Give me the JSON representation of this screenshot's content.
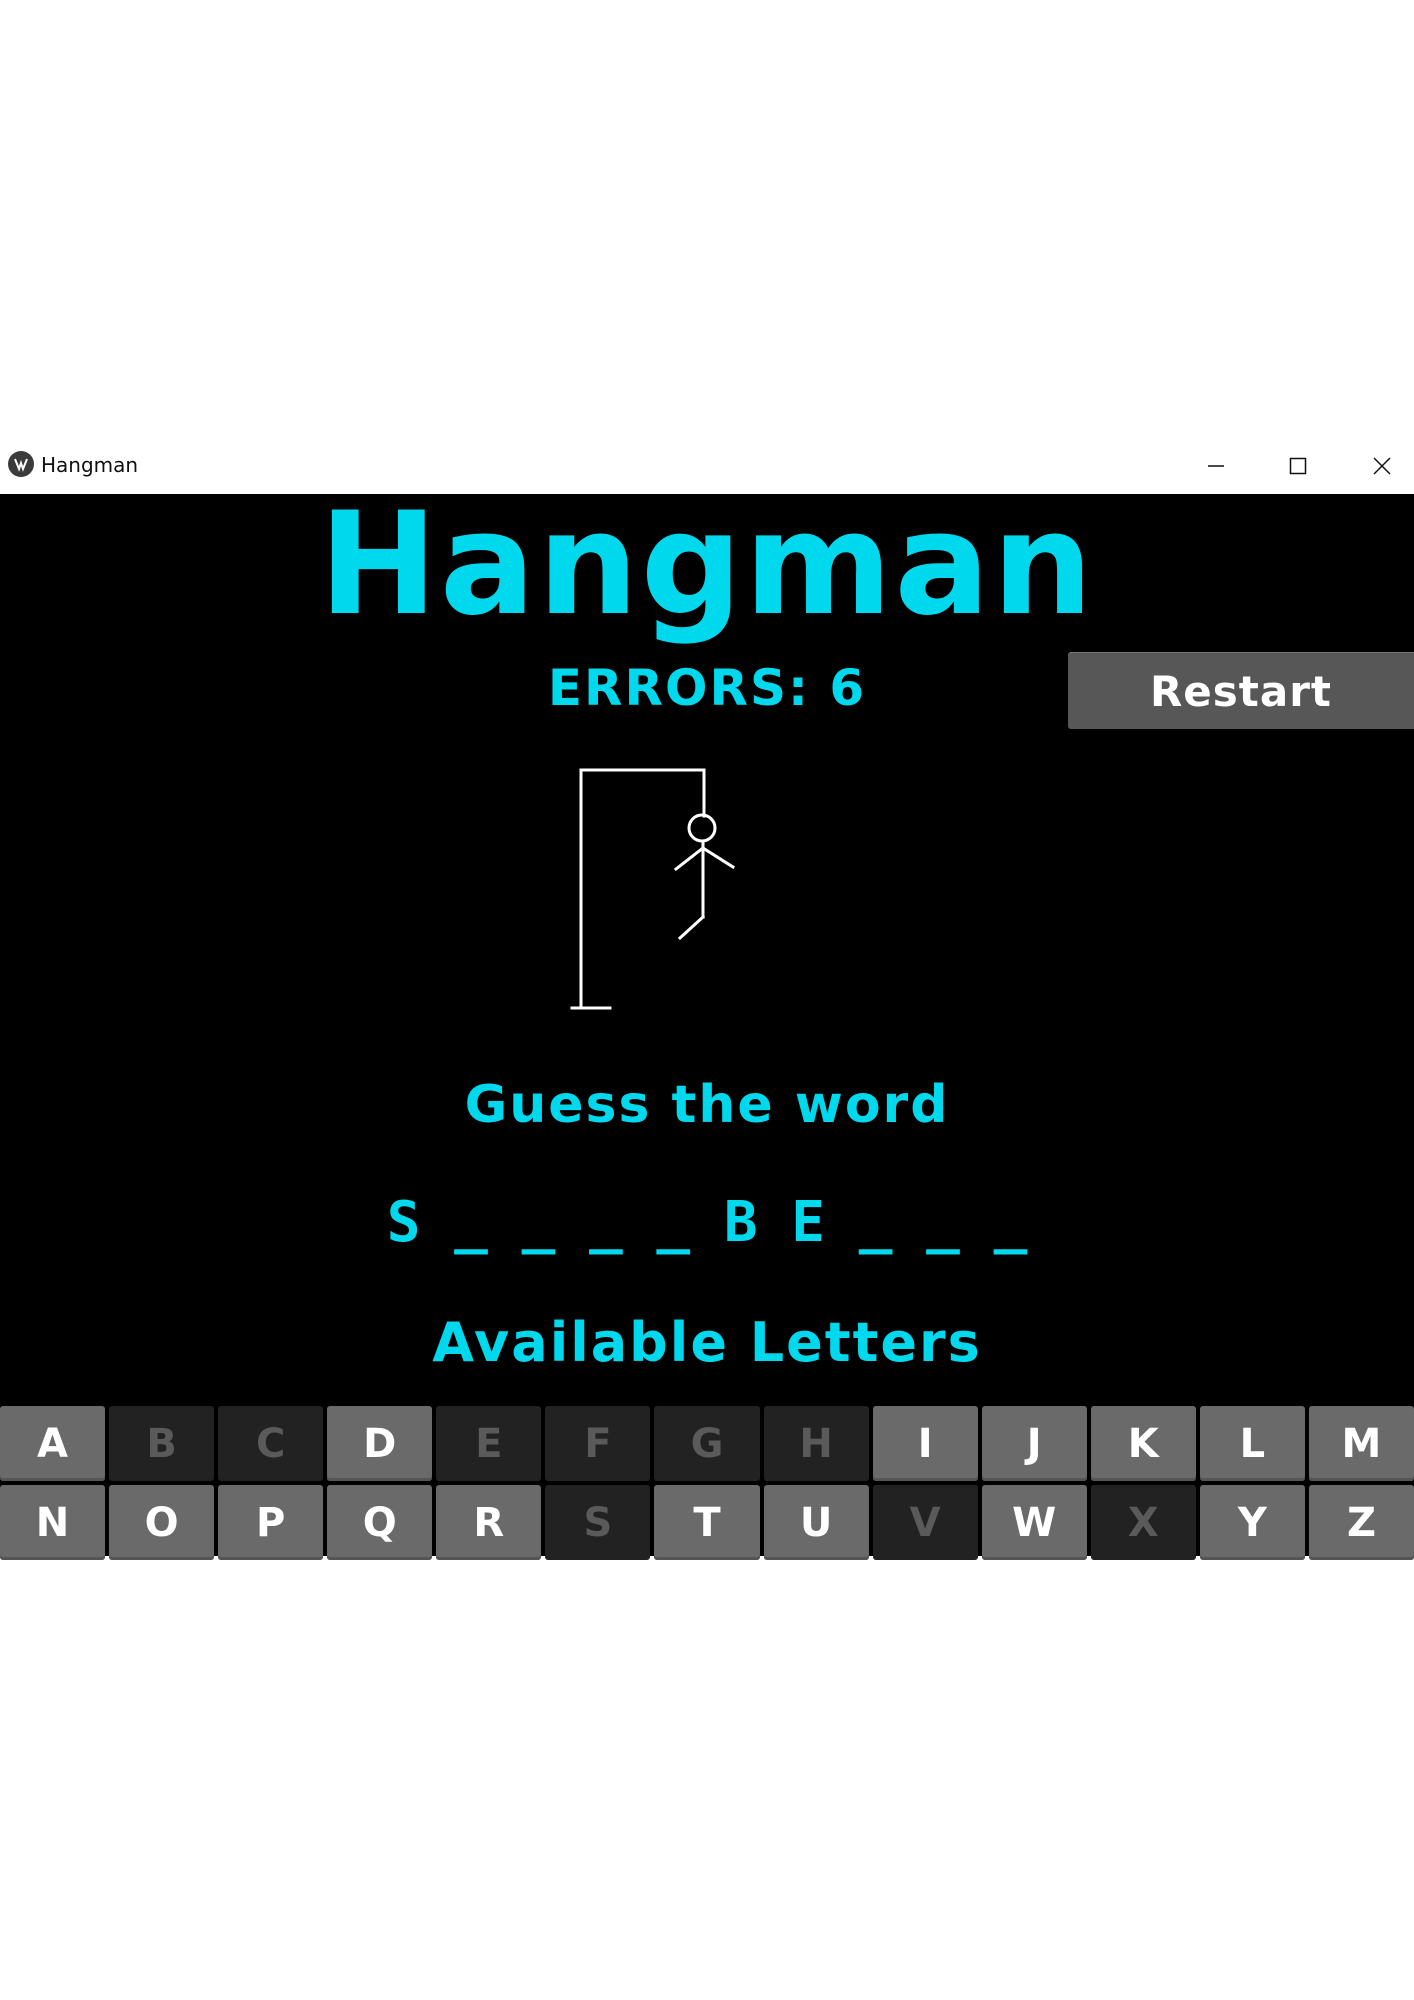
{
  "window": {
    "title": "Hangman"
  },
  "game": {
    "title": "Hangman",
    "errors_text": "ERRORS: 6",
    "restart_label": "Restart",
    "prompt": "Guess the word",
    "word_display": "S _ _ _ _ B E _ _ _",
    "available_heading": "Available Letters"
  },
  "keyboard": {
    "keys": [
      {
        "letter": "A",
        "enabled": true
      },
      {
        "letter": "B",
        "enabled": false
      },
      {
        "letter": "C",
        "enabled": false
      },
      {
        "letter": "D",
        "enabled": true
      },
      {
        "letter": "E",
        "enabled": false
      },
      {
        "letter": "F",
        "enabled": false
      },
      {
        "letter": "G",
        "enabled": false
      },
      {
        "letter": "H",
        "enabled": false
      },
      {
        "letter": "I",
        "enabled": true
      },
      {
        "letter": "J",
        "enabled": true
      },
      {
        "letter": "K",
        "enabled": true
      },
      {
        "letter": "L",
        "enabled": true
      },
      {
        "letter": "M",
        "enabled": true
      },
      {
        "letter": "N",
        "enabled": true
      },
      {
        "letter": "O",
        "enabled": true
      },
      {
        "letter": "P",
        "enabled": true
      },
      {
        "letter": "Q",
        "enabled": true
      },
      {
        "letter": "R",
        "enabled": true
      },
      {
        "letter": "S",
        "enabled": false
      },
      {
        "letter": "T",
        "enabled": true
      },
      {
        "letter": "U",
        "enabled": true
      },
      {
        "letter": "V",
        "enabled": false
      },
      {
        "letter": "W",
        "enabled": true
      },
      {
        "letter": "X",
        "enabled": false
      },
      {
        "letter": "Y",
        "enabled": true
      },
      {
        "letter": "Z",
        "enabled": true
      }
    ]
  },
  "colors": {
    "accent": "#00d8ee",
    "background": "#000000",
    "key_enabled": "#6a6a6a",
    "key_disabled": "#222222"
  }
}
